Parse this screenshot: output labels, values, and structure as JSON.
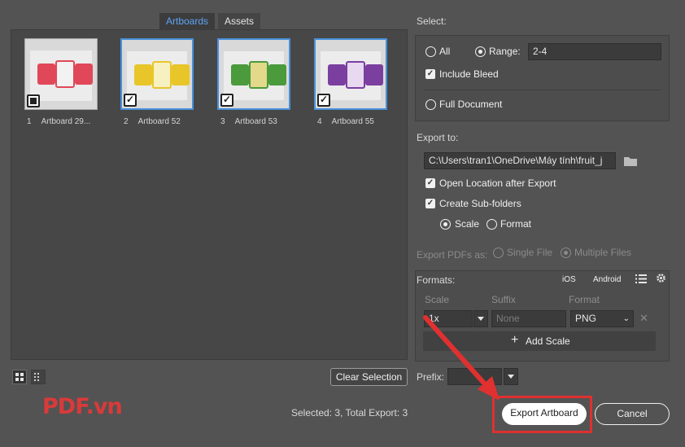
{
  "tabs": [
    {
      "label": "Artboards",
      "active": true
    },
    {
      "label": "Assets",
      "active": false
    }
  ],
  "artboards": [
    {
      "num": "1",
      "name": "Artboard 29...",
      "selected": false,
      "accent": "#e0485a"
    },
    {
      "num": "2",
      "name": "Artboard 52",
      "selected": true,
      "accent": "#e8c62a"
    },
    {
      "num": "3",
      "name": "Artboard 53",
      "selected": true,
      "accent": "#4b9a3c"
    },
    {
      "num": "4",
      "name": "Artboard 55",
      "selected": true,
      "accent": "#7b3fa0"
    }
  ],
  "clear_selection": "Clear Selection",
  "select": {
    "title": "Select:",
    "all_label": "All",
    "range_label": "Range:",
    "range_value": "2-4",
    "include_bleed": "Include Bleed",
    "full_document": "Full Document"
  },
  "export_to": {
    "title": "Export to:",
    "path": "C:\\Users\\tran1\\OneDrive\\Máy tính\\fruit_j",
    "open_location": "Open Location after Export",
    "create_subfolders": "Create Sub-folders",
    "scale_label": "Scale",
    "format_label": "Format"
  },
  "export_pdfs": {
    "title": "Export PDFs as:",
    "single_file": "Single File",
    "multiple_files": "Multiple Files"
  },
  "formats": {
    "title": "Formats:",
    "ios": "iOS",
    "android": "Android",
    "col_scale": "Scale",
    "col_suffix": "Suffix",
    "col_format": "Format",
    "row_scale": "1x",
    "row_suffix_placeholder": "None",
    "row_format": "PNG",
    "add_scale": "Add Scale"
  },
  "prefix_label": "Prefix:",
  "status": "Selected: 3, Total Export: 3",
  "export_button": "Export Artboard",
  "cancel_button": "Cancel",
  "watermark": "PDF.vn",
  "colors": {
    "accent_blue": "#4a90d9",
    "highlight_red": "#e03030"
  }
}
